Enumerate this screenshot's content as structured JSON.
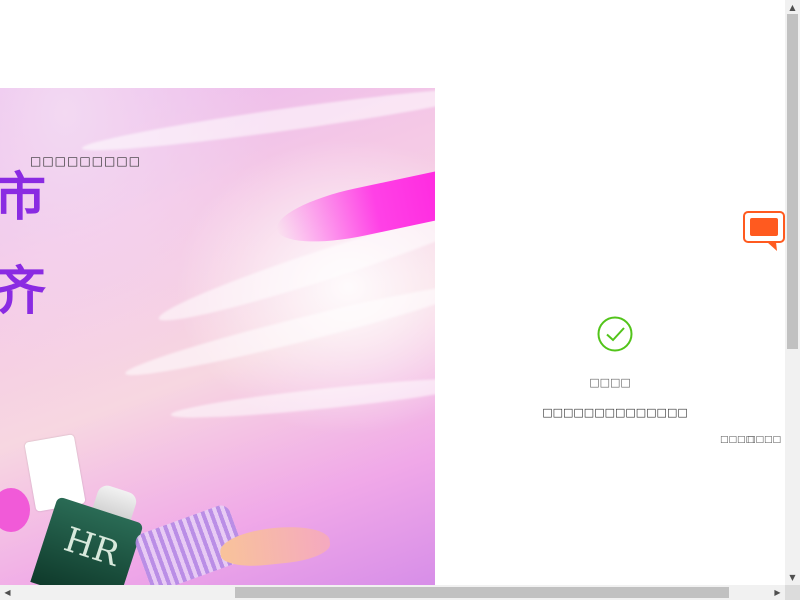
{
  "banner": {
    "line1": "市",
    "line2": "齐",
    "bottle_monogram": "HR"
  },
  "panel": {
    "title": "□□□□□□□□□",
    "status_label": "□□□□",
    "status_message": "□□□□□□□□□□□□□□",
    "links": [
      {
        "label": "□□□□"
      },
      {
        "label": "□□□□"
      }
    ]
  },
  "icons": {
    "chat": "chat-bubble-icon",
    "success": "check-circle-icon"
  },
  "colors": {
    "chat_icon": "#ff5a1f",
    "success_icon": "#52c41a",
    "banner_text": "#8a2be2"
  },
  "scroll": {
    "vertical_arrow_up": "▲",
    "vertical_arrow_down": "▼",
    "horizontal_arrow_left": "◀",
    "horizontal_arrow_right": "▶"
  }
}
